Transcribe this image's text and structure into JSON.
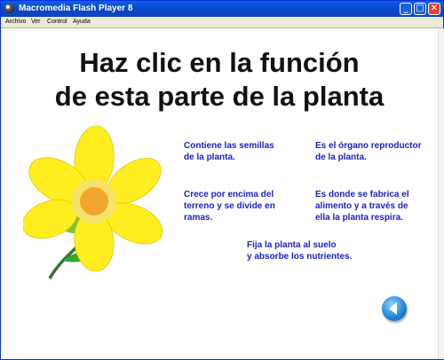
{
  "window": {
    "title": "Macromedia Flash Player 8",
    "controls": {
      "minimize": "_",
      "maximize": "□",
      "close": "✕"
    }
  },
  "menu": [
    "Archivo",
    "Ver",
    "Control",
    "Ayuda"
  ],
  "heading": {
    "line1": "Haz clic en la función",
    "line2": "de esta parte de la planta"
  },
  "options": [
    {
      "lines": [
        "Contiene las semillas",
        "de la planta."
      ]
    },
    {
      "lines": [
        "Es el órgano reproductor",
        "de la planta."
      ]
    },
    {
      "lines": [
        "Crece por encima del",
        "terreno y se divide en",
        "ramas."
      ]
    },
    {
      "lines": [
        "Es donde  se fabrica el",
        "alimento y a través de",
        "ella la planta respira."
      ]
    },
    {
      "lines": [
        "Fija la planta al suelo",
        "y absorbe los nutrientes."
      ]
    }
  ],
  "icons": {
    "app": "flash-player-icon",
    "back": "back-arrow-icon",
    "illustration": "flower-illustration"
  },
  "colors": {
    "title_bar": "#0747c6",
    "option_text": "#1a22c8",
    "petals": "#ffee1f",
    "center": "#f4a52e",
    "stem": "#2c7a2c",
    "back_button": "#1e7fd8"
  }
}
